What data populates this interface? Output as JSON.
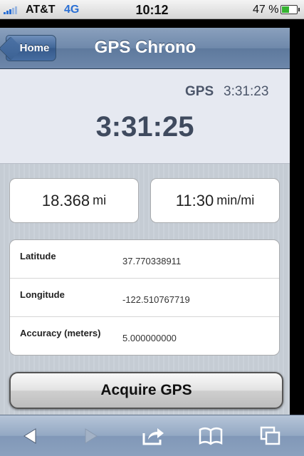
{
  "status_bar": {
    "carrier": "AT&T",
    "network": "4G",
    "time": "10:12",
    "battery_percent_label": "47 %",
    "battery_level": 0.47,
    "battery_color": "#35b331"
  },
  "nav_bar": {
    "back_label": "Home",
    "title": "GPS Chrono"
  },
  "header": {
    "gps_label": "GPS",
    "gps_time": "3:31:23",
    "elapsed_time": "3:31:25"
  },
  "stats": {
    "distance_value": "18.368",
    "distance_unit": "mi",
    "pace_value": "11:30",
    "pace_unit": "min/mi"
  },
  "location": {
    "rows": [
      {
        "label": "Latitude",
        "value": "37.770338911"
      },
      {
        "label": "Longitude",
        "value": "-122.510767719"
      },
      {
        "label": "Accuracy (meters)",
        "value": "5.000000000"
      }
    ]
  },
  "actions": {
    "acquire_label": "Acquire GPS"
  },
  "toolbar": {
    "icons": [
      "back-arrow-icon",
      "forward-arrow-icon",
      "share-icon",
      "bookmarks-icon",
      "tabs-icon"
    ]
  }
}
